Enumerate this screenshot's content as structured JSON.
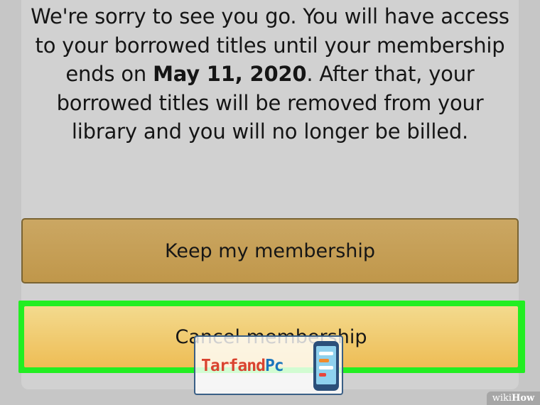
{
  "dialog": {
    "message_line1": "We're sorry to see you go. You will have access",
    "message_line2": "to your borrowed titles until your membership",
    "message_line3_pre": "ends on ",
    "message_date": "May 11, 2020",
    "message_line3_post": ". After that, your",
    "message_line4": "borrowed titles will be removed from your",
    "message_line5": "library and you will no longer be billed.",
    "keep_label": "Keep my membership",
    "cancel_label": "Cancel membership"
  },
  "watermark": {
    "text_part1": "Tarfand",
    "text_part2": "Pc",
    "credit_part1": "wiki",
    "credit_part2": "How"
  },
  "colors": {
    "highlight": "#22ee22",
    "keep_button": "#c4a053",
    "cancel_button": "#f0c868"
  }
}
